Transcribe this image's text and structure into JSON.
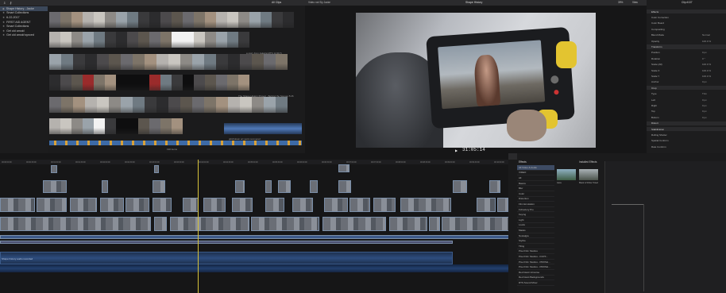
{
  "libraries": {
    "items": [
      {
        "label": "Shape History - Jacke",
        "selected": true
      },
      {
        "label": "Smart Collections",
        "selected": false
      },
      {
        "label": "6-22-2017",
        "selected": false
      },
      {
        "label": "FIRST AID AGENT",
        "selected": false
      },
      {
        "label": "Smart Collections",
        "selected": false
      },
      {
        "label": "Get old amoid",
        "selected": false
      },
      {
        "label": "Get old amoid synced",
        "selected": false
      }
    ]
  },
  "browser": {
    "filter": "All Clips",
    "captions": [
      "a story from Jakarta MTS 14:30 5",
      "The Shape History Project - Behind the Scenes 5:26",
      "glitchdown art work recovered"
    ],
    "item_count": "190 items"
  },
  "viewer": {
    "left_title": "Video not Sly Jacke",
    "title": "Shape History",
    "zoom": "39%",
    "view_menu": "View",
    "timecode": "31:05:14"
  },
  "inspector": {
    "clip_label": "Clip #137",
    "rows": [
      "Effects",
      "Color Correction",
      "Color Board",
      "Compositing",
      "Blend Mode",
      "Opacity",
      "Transform",
      "Position",
      "Rotation",
      "Scale (All)",
      "Scale X",
      "Scale Y",
      "Anchor",
      "Crop",
      "Type",
      "Left",
      "Right",
      "Top",
      "Bottom",
      "Distort",
      "Stabilization",
      "Rolling Shutter",
      "Spatial Conform",
      "Rate Conform"
    ],
    "values": [
      "Normal",
      "100.0 %",
      "0 px",
      "0 °",
      "100.0 %",
      "100.0 %",
      "100.0 %",
      "0 px",
      "Trim",
      "0 px",
      "0 px",
      "0 px",
      "0 px"
    ]
  },
  "timeline": {
    "index_label": "Index",
    "title": "Shape History",
    "duration": "31:05:14",
    "ruler": [
      "00:00:00:00",
      "00:00:30:00",
      "00:01:00:00",
      "00:01:30:00",
      "00:02:00:00",
      "00:02:30:00",
      "00:03:00:00",
      "00:03:30:00",
      "00:04:00:00",
      "00:04:30:00",
      "00:05:00:00",
      "00:05:30:00",
      "00:06:00:00",
      "00:06:30:00",
      "00:07:00:00",
      "00:07:30:00",
      "00:08:00:00",
      "00:08:30:00",
      "00:09:00:00",
      "00:09:30:00",
      "00:10:00:00"
    ],
    "audio_label": "Shape history audio recorded"
  },
  "effects": {
    "header": "Effects",
    "installed_label": "Installed Effects",
    "categories": [
      "All Video & Audio",
      "VIDEO",
      "All",
      "Basics",
      "Blur",
      "Color",
      "Distortion",
      "Film Emulation",
      "FxFactory Pro",
      "Keying",
      "Light",
      "Looks",
      "Masks",
      "Nostalgia",
      "Stylize",
      "Tiling",
      "Pixel Film Studios",
      "Pixel Film Studios - FCPX...",
      "Pixel Film Studios - PROSH...",
      "Pixel Film Studios - PROSH...",
      "Red Giant Universe",
      "Red Giant Backgrounds",
      "RTS Sound Mixer"
    ],
    "thumbs": [
      "Glow",
      "Black & White Tinted"
    ]
  },
  "colors": {
    "accent": "#3d4b63",
    "playhead": "#d7c33a",
    "clip_blue": "#4a5d78"
  }
}
